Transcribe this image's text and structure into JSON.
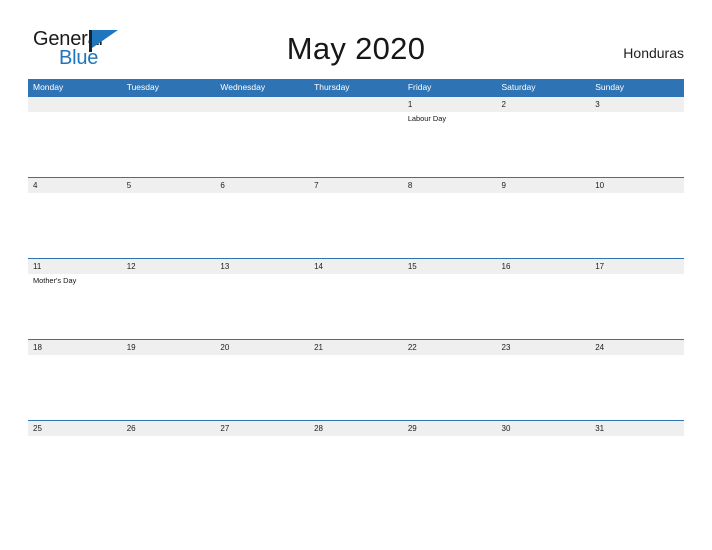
{
  "brand": {
    "name_part1": "General",
    "name_part2": "Blue",
    "flag_icon": "general-blue-flag-icon",
    "colors": {
      "text_dark": "#1a1a1a",
      "blue": "#1f76bc"
    }
  },
  "header": {
    "title": "May 2020",
    "locale": "Honduras"
  },
  "calendar": {
    "header_color": "#2e74b5",
    "date_band_color": "#efefef",
    "weekdays": [
      "Monday",
      "Tuesday",
      "Wednesday",
      "Thursday",
      "Friday",
      "Saturday",
      "Sunday"
    ],
    "weeks": [
      {
        "days": [
          {
            "date": "",
            "event": ""
          },
          {
            "date": "",
            "event": ""
          },
          {
            "date": "",
            "event": ""
          },
          {
            "date": "",
            "event": ""
          },
          {
            "date": "1",
            "event": "Labour Day"
          },
          {
            "date": "2",
            "event": ""
          },
          {
            "date": "3",
            "event": ""
          }
        ]
      },
      {
        "days": [
          {
            "date": "4",
            "event": ""
          },
          {
            "date": "5",
            "event": ""
          },
          {
            "date": "6",
            "event": ""
          },
          {
            "date": "7",
            "event": ""
          },
          {
            "date": "8",
            "event": ""
          },
          {
            "date": "9",
            "event": ""
          },
          {
            "date": "10",
            "event": ""
          }
        ]
      },
      {
        "days": [
          {
            "date": "11",
            "event": "Mother's Day"
          },
          {
            "date": "12",
            "event": ""
          },
          {
            "date": "13",
            "event": ""
          },
          {
            "date": "14",
            "event": ""
          },
          {
            "date": "15",
            "event": ""
          },
          {
            "date": "16",
            "event": ""
          },
          {
            "date": "17",
            "event": ""
          }
        ]
      },
      {
        "days": [
          {
            "date": "18",
            "event": ""
          },
          {
            "date": "19",
            "event": ""
          },
          {
            "date": "20",
            "event": ""
          },
          {
            "date": "21",
            "event": ""
          },
          {
            "date": "22",
            "event": ""
          },
          {
            "date": "23",
            "event": ""
          },
          {
            "date": "24",
            "event": ""
          }
        ]
      },
      {
        "days": [
          {
            "date": "25",
            "event": ""
          },
          {
            "date": "26",
            "event": ""
          },
          {
            "date": "27",
            "event": ""
          },
          {
            "date": "28",
            "event": ""
          },
          {
            "date": "29",
            "event": ""
          },
          {
            "date": "30",
            "event": ""
          },
          {
            "date": "31",
            "event": ""
          }
        ]
      }
    ]
  }
}
